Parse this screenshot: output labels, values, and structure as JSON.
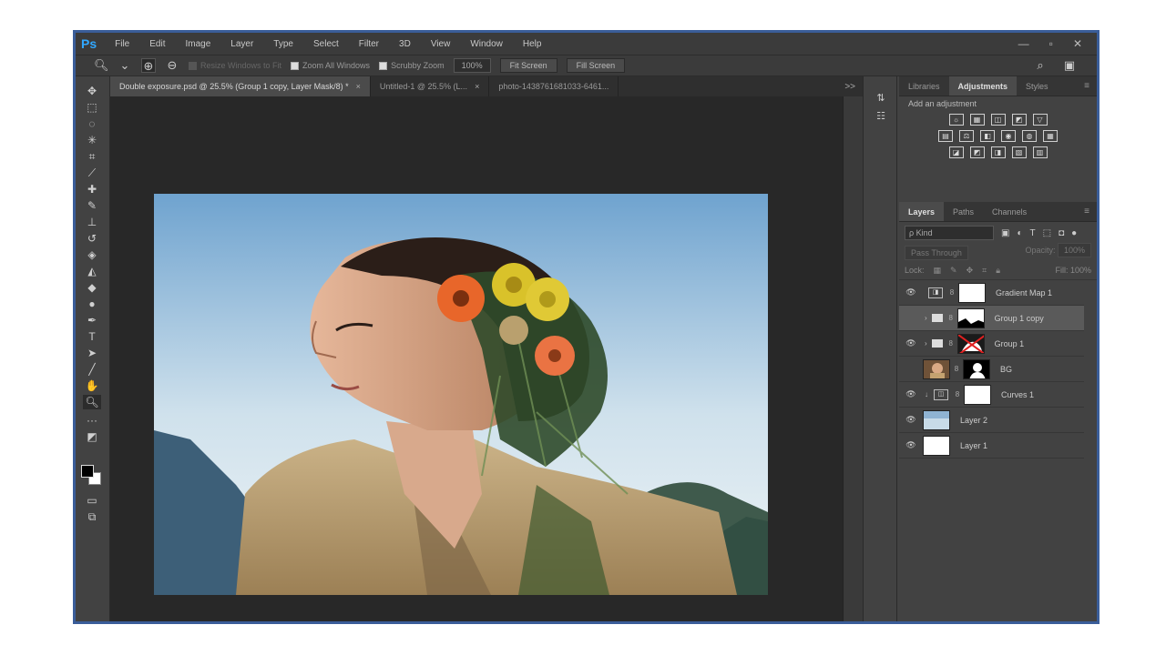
{
  "menu": {
    "logo": "Ps",
    "items": [
      "File",
      "Edit",
      "Image",
      "Layer",
      "Type",
      "Select",
      "Filter",
      "3D",
      "View",
      "Window",
      "Help"
    ],
    "window_controls": [
      "—",
      "▫",
      "✕"
    ]
  },
  "options_bar": {
    "resize_windows_label": "Resize Windows to Fit",
    "zoom_all_label": "Zoom All Windows",
    "scrubby_zoom_label": "Scrubby Zoom",
    "zoom_value": "100%",
    "fit_screen_label": "Fit Screen",
    "fill_screen_label": "Fill Screen"
  },
  "tabs": [
    {
      "label": "Double exposure.psd @ 25.5% (Group 1 copy, Layer Mask/8) *",
      "close": "×",
      "active": true
    },
    {
      "label": "Untitled-1 @ 25.5% (L...",
      "close": "×",
      "active": false
    },
    {
      "label": "photo-1438761681033-6461...",
      "close": "",
      "active": false
    }
  ],
  "tabs_overflow": ">>",
  "adjust_panel": {
    "tabs": [
      "Libraries",
      "Adjustments",
      "Styles"
    ],
    "active_tab": "Adjustments",
    "title": "Add an adjustment",
    "rows": [
      [
        "☼",
        "▦",
        "◫",
        "◩",
        "▽"
      ],
      [
        "▤",
        "⚖",
        "◧",
        "◉",
        "◍",
        "▦"
      ],
      [
        "◪",
        "◩",
        "◨",
        "▧",
        "▥"
      ]
    ]
  },
  "layers_panel": {
    "tabs": [
      "Layers",
      "Paths",
      "Channels"
    ],
    "active_tab": "Layers",
    "kind_filter": "ρ Kind",
    "blend_mode": "Pass Through",
    "opacity_label": "Opacity:",
    "opacity_value": "100%",
    "lock_label": "Lock:",
    "fill_label": "Fill:",
    "fill_value": "100%",
    "layers": [
      {
        "name": "Gradient Map 1",
        "visible": true,
        "selected": false
      },
      {
        "name": "Group 1 copy",
        "visible": false,
        "selected": true
      },
      {
        "name": "Group 1",
        "visible": true,
        "selected": false
      },
      {
        "name": "BG",
        "visible": false,
        "selected": false
      },
      {
        "name": "Curves 1",
        "visible": true,
        "selected": false
      },
      {
        "name": "Layer 2",
        "visible": true,
        "selected": false
      },
      {
        "name": "Layer 1",
        "visible": true,
        "selected": false
      }
    ]
  },
  "colors": {
    "frame_border": "#3a5d99",
    "ps_blue": "#31a8ff",
    "ui_dark": "#424242",
    "canvas_bg": "#282828"
  }
}
